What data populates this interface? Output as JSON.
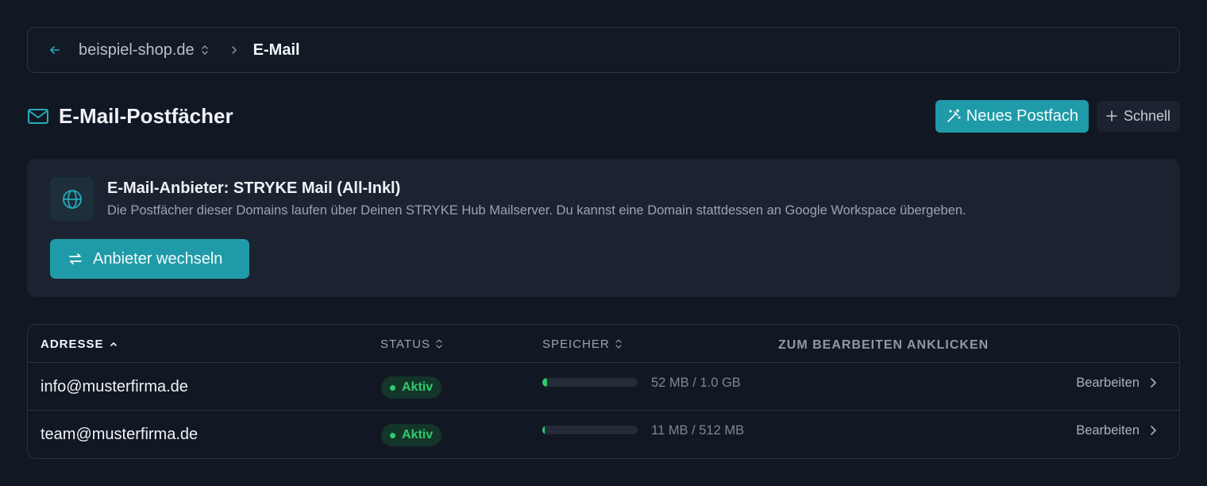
{
  "breadcrumb": {
    "domain": "beispiel-shop.de",
    "current": "E-Mail"
  },
  "header": {
    "title": "E-Mail-Postfächer",
    "new_mailbox_label": "Neues Postfach",
    "quick_label": "Schnell"
  },
  "provider": {
    "title": "E-Mail-Anbieter: STRYKE Mail (All-Inkl)",
    "description": "Die Postfächer dieser Domains laufen über Deinen STRYKE Hub Mailserver. Du kannst eine Domain stattdessen an Google Workspace übergeben.",
    "switch_label": "Anbieter wechseln"
  },
  "table": {
    "columns": {
      "address": "ADRESSE",
      "status": "STATUS",
      "storage": "SPEICHER",
      "hint": "ZUM BEARBEITEN ANKLICKEN"
    },
    "rows": [
      {
        "address": "info@musterfirma.de",
        "status": "Aktiv",
        "storage_text": "52 MB / 1.0 GB",
        "storage_fraction": 0.05,
        "edit_label": "Bearbeiten"
      },
      {
        "address": "team@musterfirma.de",
        "status": "Aktiv",
        "storage_text": "11 MB / 512 MB",
        "storage_fraction": 0.021,
        "edit_label": "Bearbeiten"
      }
    ]
  },
  "colors": {
    "accent": "#1f9aa8",
    "status_active": "#2fcb6c",
    "background": "#111823"
  }
}
